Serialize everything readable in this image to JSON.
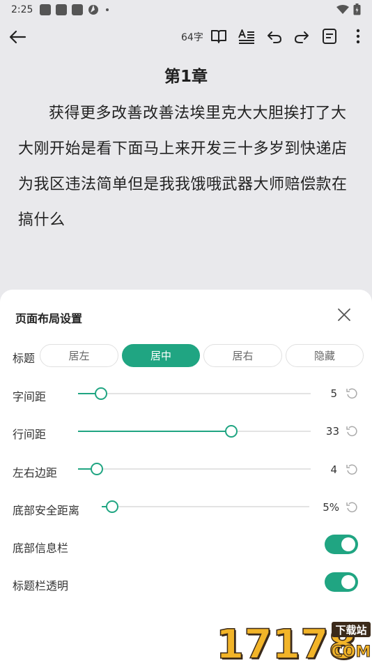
{
  "status_bar": {
    "time": "2:25"
  },
  "toolbar": {
    "word_count": "64字"
  },
  "reader": {
    "chapter_title": "第1章",
    "content": "获得更多改善改善法埃里克大大胆挨打了大大刚开始是看下面马上来开发三十多岁到快递店为我区违法简单但是我我饿哦武器大师赔偿款在搞什么"
  },
  "sheet": {
    "title": "页面布局设置",
    "title_row": {
      "label": "标题",
      "options": [
        "居左",
        "居中",
        "居右",
        "隐藏"
      ],
      "selected": "居中"
    },
    "sliders": [
      {
        "label": "字间距",
        "value": "5",
        "level": 0.1
      },
      {
        "label": "行间距",
        "value": "33",
        "level": 0.66
      },
      {
        "label": "左右边距",
        "value": "4",
        "level": 0.08
      },
      {
        "label": "底部安全距离",
        "value": "5%",
        "level": 0.05
      }
    ],
    "toggles": [
      {
        "label": "底部信息栏",
        "on": true
      },
      {
        "label": "标题栏透明",
        "on": true
      }
    ]
  },
  "watermark": {
    "text": "17178",
    "badge_top": "下载站",
    "badge_bottom": "COM"
  },
  "colors": {
    "accent": "#20a582",
    "background": "#e9e9ec",
    "sheet": "#ffffff"
  }
}
